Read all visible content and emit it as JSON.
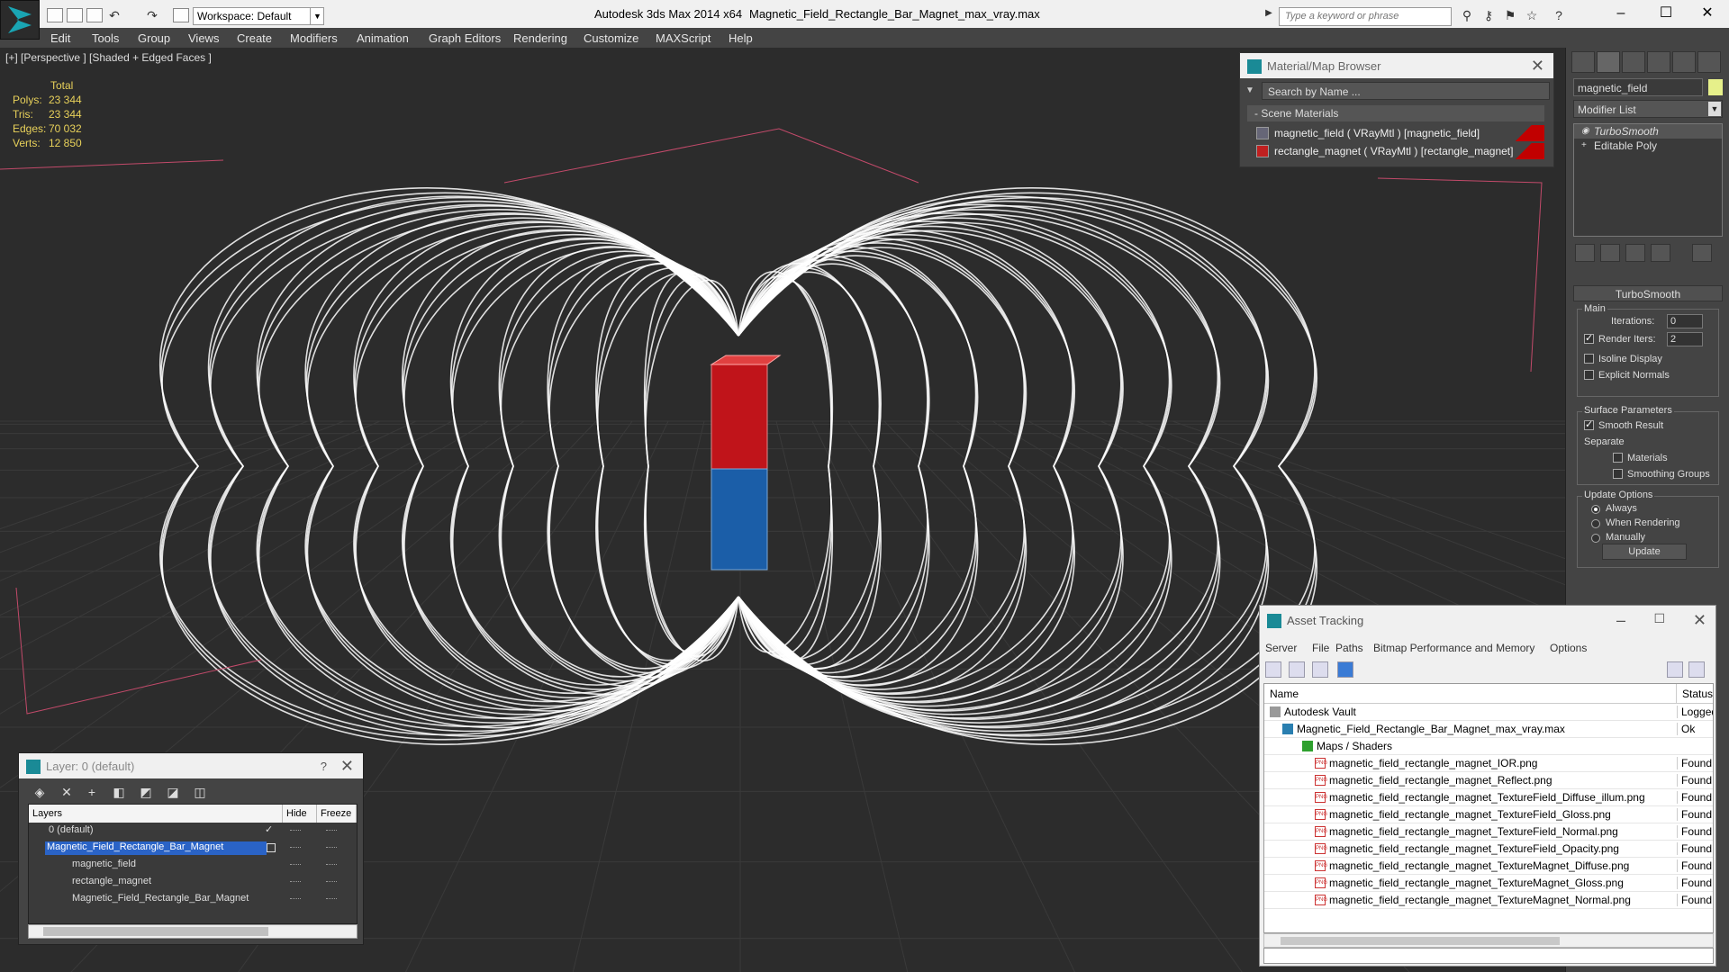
{
  "titlebar": {
    "workspace": "Workspace: Default",
    "app_title": "Autodesk 3ds Max  2014 x64",
    "file_title": "Magnetic_Field_Rectangle_Bar_Magnet_max_vray.max",
    "search_placeholder": "Type a keyword or phrase"
  },
  "menu": [
    "Edit",
    "Tools",
    "Group",
    "Views",
    "Create",
    "Modifiers",
    "Animation",
    "Graph Editors",
    "Rendering",
    "Customize",
    "MAXScript",
    "Help"
  ],
  "viewport": {
    "label": "[+] [Perspective ] [Shaded + Edged Faces ]",
    "stats": {
      "total_label": "Total",
      "rows": [
        {
          "label": "Polys:",
          "value": "23 344"
        },
        {
          "label": "Tris:",
          "value": "23 344"
        },
        {
          "label": "Edges:",
          "value": "70 032"
        },
        {
          "label": "Verts:",
          "value": "12 850"
        }
      ]
    },
    "colors": {
      "background": "#2c2c2c",
      "wire": "#ffffff",
      "magnet_north": "#c0141a",
      "magnet_south": "#1b5ea8",
      "grid": "#3a3a3a"
    }
  },
  "material_browser": {
    "title": "Material/Map Browser",
    "search_placeholder": "Search by Name ...",
    "section": "- Scene Materials",
    "materials": [
      "magnetic_field  ( VRayMtl ) [magnetic_field]",
      "rectangle_magnet  ( VRayMtl ) [rectangle_magnet]"
    ]
  },
  "command_panel": {
    "object_name": "magnetic_field",
    "modifier_list": "Modifier List",
    "stack": [
      "TurboSmooth",
      "Editable Poly"
    ],
    "rollout_title": "TurboSmooth",
    "main_label": "Main",
    "iterations_label": "Iterations:",
    "iterations_value": "0",
    "render_iters_label": "Render Iters:",
    "render_iters_value": "2",
    "isoline_label": "Isoline Display",
    "explicit_normals_label": "Explicit Normals",
    "surface_params_label": "Surface Parameters",
    "smooth_result_label": "Smooth Result",
    "separate_label": "Separate",
    "materials_label": "Materials",
    "smoothing_groups_label": "Smoothing Groups",
    "update_options_label": "Update Options",
    "always_label": "Always",
    "when_rendering_label": "When Rendering",
    "manually_label": "Manually",
    "update_button": "Update"
  },
  "layer_panel": {
    "title": "Layer: 0 (default)",
    "columns": {
      "layers": "Layers",
      "hide": "Hide",
      "freeze": "Freeze"
    },
    "rows": [
      {
        "name": "0 (default)"
      },
      {
        "name": "Magnetic_Field_Rectangle_Bar_Magnet"
      },
      {
        "name": "magnetic_field"
      },
      {
        "name": "rectangle_magnet"
      },
      {
        "name": "Magnetic_Field_Rectangle_Bar_Magnet"
      }
    ]
  },
  "asset_tracking": {
    "title": "Asset Tracking",
    "menu": [
      "Server",
      "File",
      "Paths",
      "Bitmap Performance and Memory",
      "Options"
    ],
    "columns": {
      "name": "Name",
      "status": "Status"
    },
    "rows": [
      {
        "name": "Autodesk Vault",
        "status": "Logged"
      },
      {
        "name": "Magnetic_Field_Rectangle_Bar_Magnet_max_vray.max",
        "status": "Ok"
      },
      {
        "name": "Maps / Shaders",
        "status": ""
      },
      {
        "name": "magnetic_field_rectangle_magnet_IOR.png",
        "status": "Found"
      },
      {
        "name": "magnetic_field_rectangle_magnet_Reflect.png",
        "status": "Found"
      },
      {
        "name": "magnetic_field_rectangle_magnet_TextureField_Diffuse_illum.png",
        "status": "Found"
      },
      {
        "name": "magnetic_field_rectangle_magnet_TextureField_Gloss.png",
        "status": "Found"
      },
      {
        "name": "magnetic_field_rectangle_magnet_TextureField_Normal.png",
        "status": "Found"
      },
      {
        "name": "magnetic_field_rectangle_magnet_TextureField_Opacity.png",
        "status": "Found"
      },
      {
        "name": "magnetic_field_rectangle_magnet_TextureMagnet_Diffuse.png",
        "status": "Found"
      },
      {
        "name": "magnetic_field_rectangle_magnet_TextureMagnet_Gloss.png",
        "status": "Found"
      },
      {
        "name": "magnetic_field_rectangle_magnet_TextureMagnet_Normal.png",
        "status": "Found"
      }
    ]
  }
}
